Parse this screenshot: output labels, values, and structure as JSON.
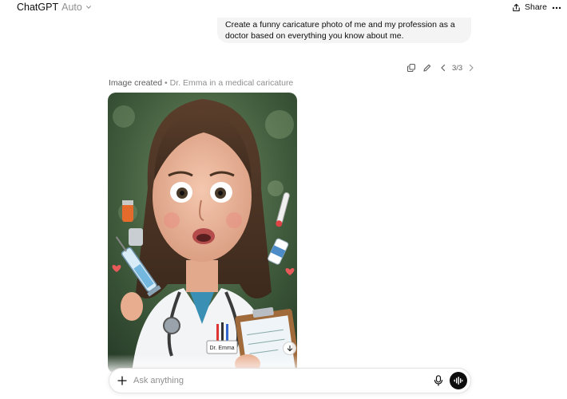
{
  "header": {
    "model_name": "ChatGPT",
    "model_mode": "Auto",
    "share_label": "Share"
  },
  "conversation": {
    "user_message_lines": [
      "Create a funny caricature photo of me and my profession as a",
      "doctor based on everything you know about me."
    ],
    "toolbar": {
      "variant_counter": "3/3"
    },
    "image_caption": {
      "label": "Image created",
      "separator": " • ",
      "subtitle": "Dr. Emma in a medical caricature"
    },
    "image": {
      "badge_text": "Dr. Emma"
    }
  },
  "composer": {
    "placeholder": "Ask anything"
  }
}
